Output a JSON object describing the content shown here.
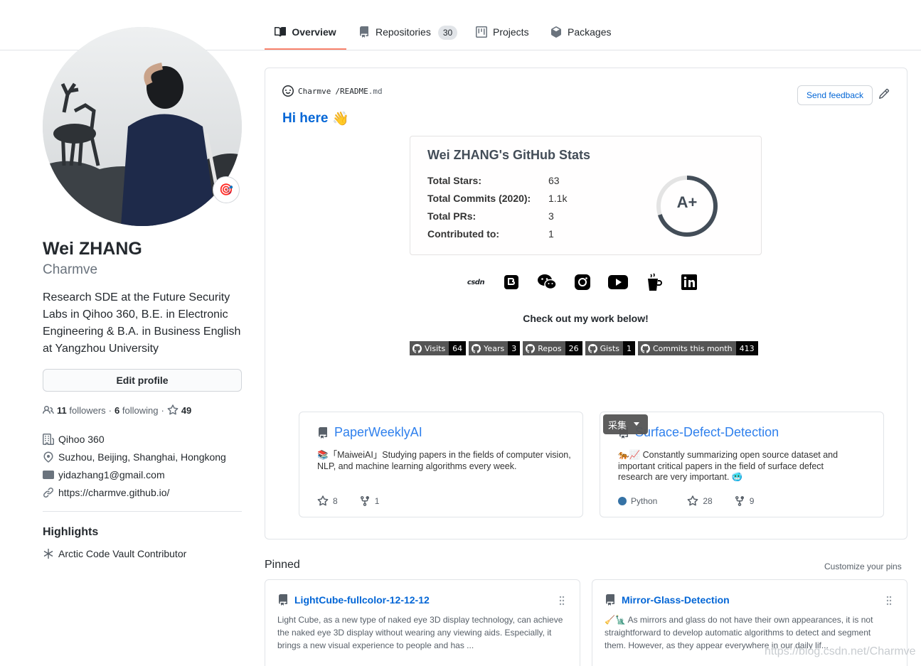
{
  "nav": {
    "tabs": [
      {
        "label": "Overview",
        "icon": "book-icon",
        "active": true
      },
      {
        "label": "Repositories",
        "icon": "repo-icon",
        "count": "30"
      },
      {
        "label": "Projects",
        "icon": "project-icon"
      },
      {
        "label": "Packages",
        "icon": "package-icon"
      }
    ]
  },
  "profile": {
    "name": "Wei ZHANG",
    "login": "Charmve",
    "bio": "Research SDE at the Future Security Labs in Qihoo 360, B.E. in Electronic Engineering & B.A. in Business English at Yangzhou University",
    "edit_label": "Edit profile",
    "followers_count": "11",
    "followers_label": "followers",
    "following_count": "6",
    "following_label": "following",
    "stars_count": "49",
    "sep": "·",
    "company": "Qihoo 360",
    "location": "Suzhou, Beijing, Shanghai, Hongkong",
    "email": "yidazhang1@gmail.com",
    "website": "https://charmve.github.io/",
    "status_emoji": "🎯",
    "highlights_title": "Highlights",
    "highlight_item": "Arctic Code Vault Contributor"
  },
  "readme": {
    "owner": "Charmve",
    "slash": "/",
    "file": "README",
    "ext": ".md",
    "feedback_label": "Send feedback",
    "greeting": "Hi here",
    "greeting_emoji": "👋",
    "stats": {
      "title": "Wei ZHANG's GitHub Stats",
      "rows": [
        {
          "label": "Total Stars:",
          "value": "63"
        },
        {
          "label": "Total Commits (2020):",
          "value": "1.1k"
        },
        {
          "label": "Total PRs:",
          "value": "3"
        },
        {
          "label": "Contributed to:",
          "value": "1"
        }
      ],
      "grade": "A+",
      "grade_progress": 0.7,
      "ring_color": "#434d58"
    },
    "social": [
      "csdn-icon",
      "blogger-icon",
      "wechat-icon",
      "instagram-icon",
      "youtube-icon",
      "coffee-icon",
      "linkedin-icon"
    ],
    "social_csdn_text": "CSDN",
    "checkout": "Check out my work below!",
    "badges": [
      {
        "label": "Visits",
        "value": "64"
      },
      {
        "label": "Years",
        "value": "3"
      },
      {
        "label": "Repos",
        "value": "26"
      },
      {
        "label": "Gists",
        "value": "1"
      },
      {
        "label": "Commits this month",
        "value": "413"
      }
    ],
    "cards": [
      {
        "title": "PaperWeeklyAI",
        "emoji": "📚",
        "desc": "「MaiweiAI」Studying papers in the fields of computer vision, NLP, and machine learning algorithms every week.",
        "stars": "8",
        "forks": "1"
      },
      {
        "title": "Surface-Defect-Detection",
        "emoji": "🐅📈",
        "desc": "Constantly summarizing open source dataset and important critical papers in the field of surface defect research are very important.",
        "desc_emoji": "🥶",
        "language": "Python",
        "language_color": "#3572A5",
        "stars": "28",
        "forks": "9"
      }
    ],
    "collect_label": "采集"
  },
  "pinned": {
    "title": "Pinned",
    "customize": "Customize your pins",
    "items": [
      {
        "title": "LightCube-fullcolor-12-12-12",
        "desc": "Light Cube, as a new type of naked eye 3D display technology, can achieve the naked eye 3D display without wearing any viewing aids. Especially, it brings a new visual experience to people and has ..."
      },
      {
        "title": "Mirror-Glass-Detection",
        "emoji": "🧹🗽",
        "desc": "As mirrors and glass do not have their own appearances, it is not straightforward to develop automatic algorithms to detect and segment them. However, as they appear everywhere in our daily lif..."
      }
    ]
  },
  "watermark": "https://blog.csdn.net/Charmve"
}
